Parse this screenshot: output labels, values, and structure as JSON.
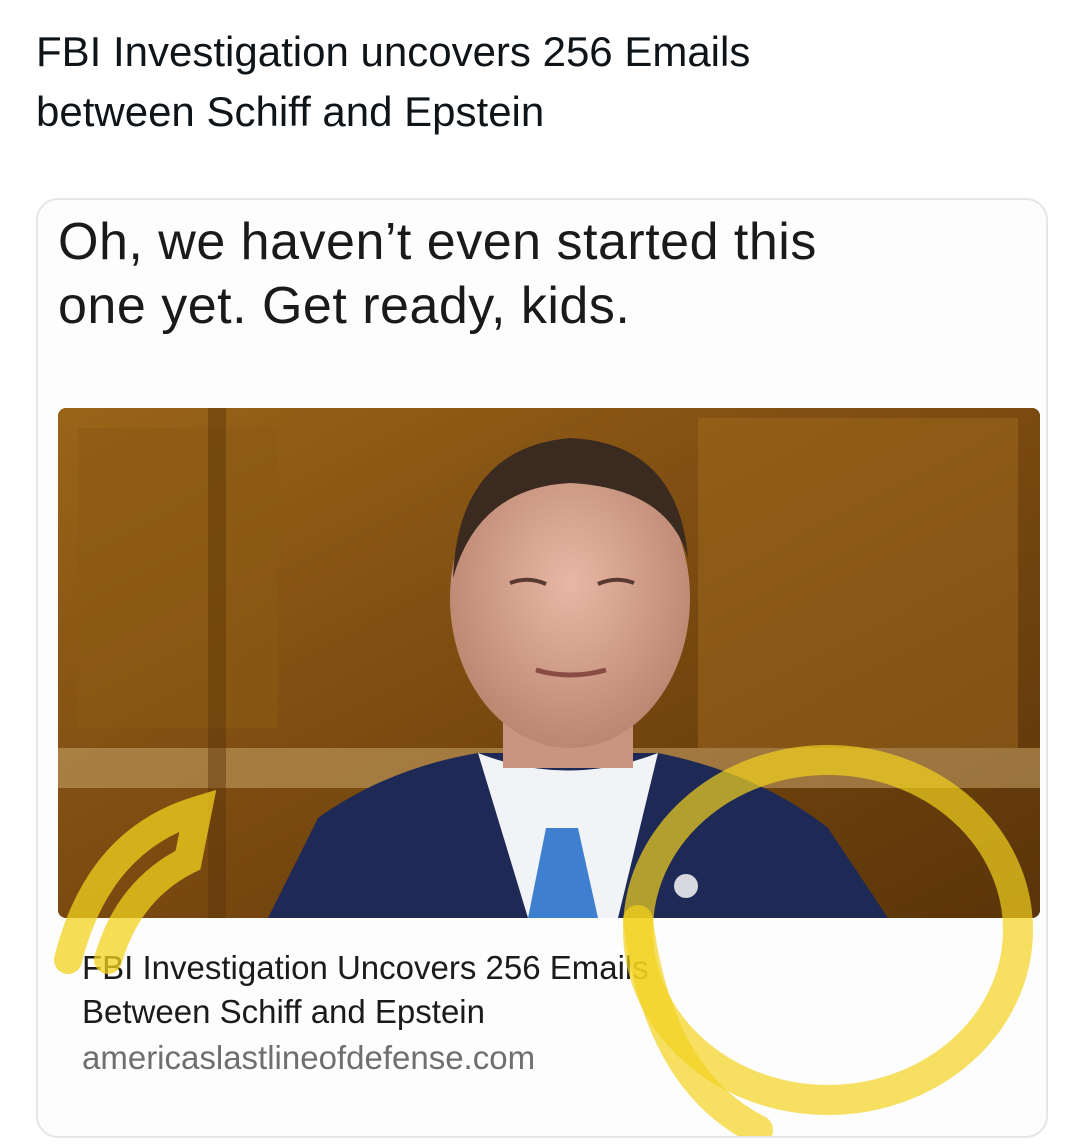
{
  "post": {
    "text_line1": "FBI Investigation uncovers 256 Emails",
    "text_line2": "between Schiff and Epstein"
  },
  "media": {
    "caption_line1": "Oh, we haven’t even started this",
    "caption_line2": "one yet. Get ready, kids.",
    "photo_icon": "photo-of-man-in-suit",
    "link_title_line1": "FBI Investigation Uncovers 256 Emails",
    "link_title_line2": "Between Schiff and Epstein",
    "link_domain": "americaslastlineofdefense.com",
    "highlight_color": "#f2d21e"
  }
}
